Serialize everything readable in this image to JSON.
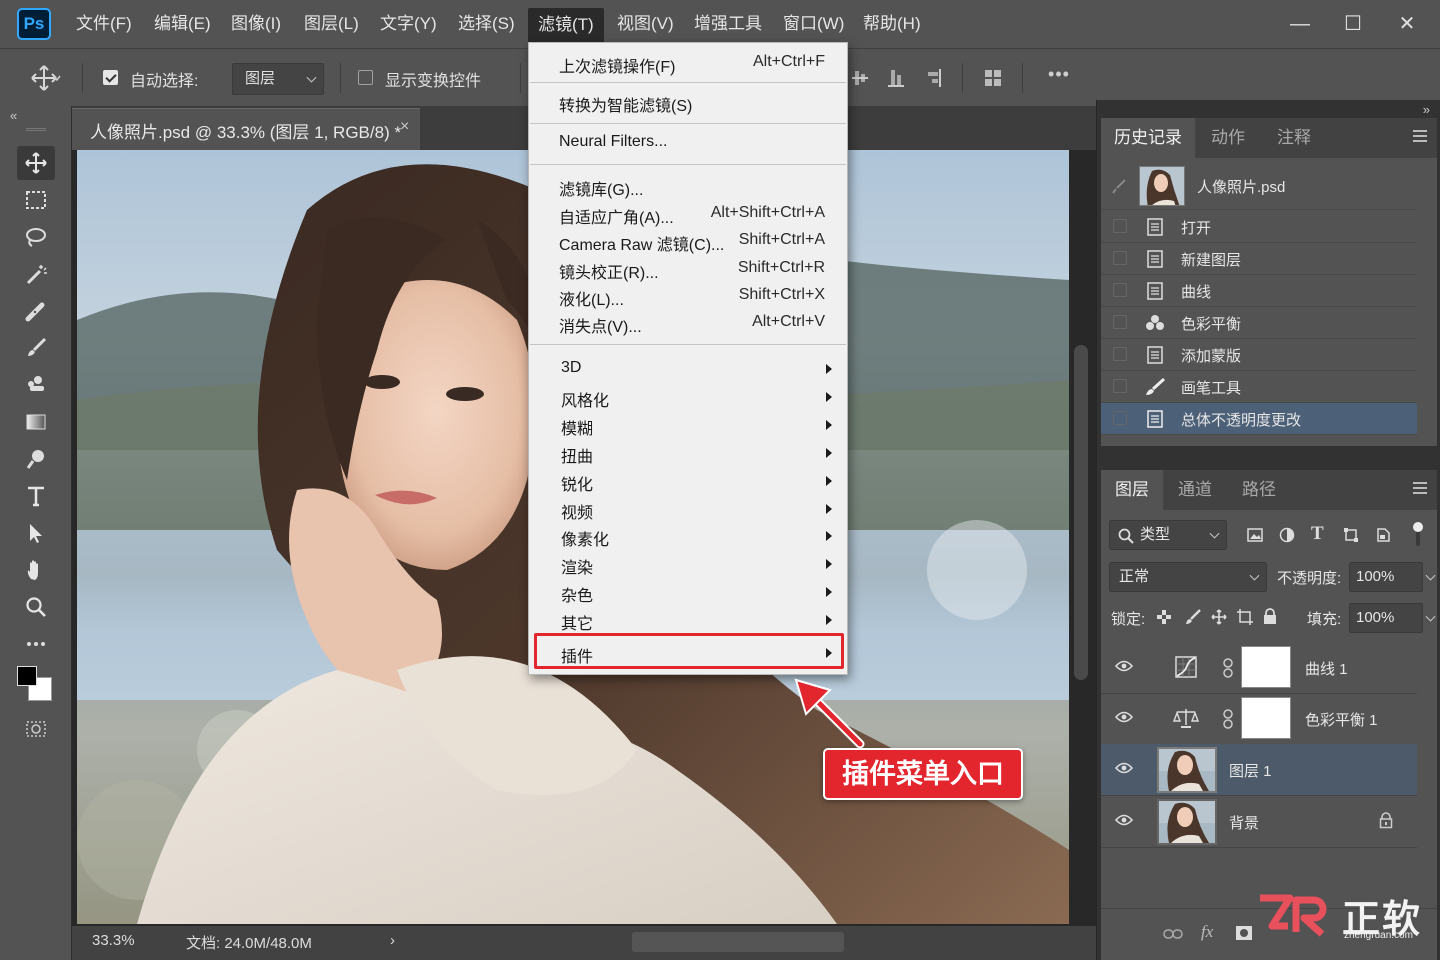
{
  "app": {
    "logo": "Ps"
  },
  "menubar": {
    "items": [
      "文件(F)",
      "编辑(E)",
      "图像(I)",
      "图层(L)",
      "文字(Y)",
      "选择(S)",
      "滤镜(T)",
      "视图(V)",
      "增强工具",
      "窗口(W)",
      "帮助(H)"
    ],
    "active": "滤镜(T)",
    "window_controls": {
      "minimize": "—",
      "maximize": "☐",
      "close": "✕"
    }
  },
  "options": {
    "auto_select_label": "自动选择:",
    "auto_select_checked": true,
    "auto_select_target": "图层",
    "show_transform_label": "显示变换控件",
    "show_transform_checked": false,
    "more": "•••"
  },
  "collapse_left": "«",
  "collapse_right": "»",
  "document": {
    "tab_title": "人像照片.psd @ 33.3% (图层 1, RGB/8) *",
    "close": "×"
  },
  "status": {
    "zoom": "33.3%",
    "doc_size": "文档: 24.0M/48.0M",
    "arrow": "›"
  },
  "filter_menu": {
    "group1": [
      {
        "label": "上次滤镜操作(F)",
        "shortcut": "Alt+Ctrl+F"
      }
    ],
    "group2": [
      {
        "label": "转换为智能滤镜(S)",
        "shortcut": ""
      }
    ],
    "group3": [
      {
        "label": "Neural Filters...",
        "shortcut": ""
      }
    ],
    "group4": [
      {
        "label": "滤镜库(G)...",
        "shortcut": ""
      },
      {
        "label": "自适应广角(A)...",
        "shortcut": "Alt+Shift+Ctrl+A"
      },
      {
        "label": "Camera Raw 滤镜(C)...",
        "shortcut": "Shift+Ctrl+A"
      },
      {
        "label": "镜头校正(R)...",
        "shortcut": "Shift+Ctrl+R"
      },
      {
        "label": "液化(L)...",
        "shortcut": "Shift+Ctrl+X"
      },
      {
        "label": "消失点(V)...",
        "shortcut": "Alt+Ctrl+V"
      }
    ],
    "submenus": [
      "3D",
      "风格化",
      "模糊",
      "扭曲",
      "锐化",
      "视频",
      "像素化",
      "渲染",
      "杂色",
      "其它"
    ],
    "plugin_item": "插件"
  },
  "annotation": {
    "text": "插件菜单入口",
    "color": "#e3262e"
  },
  "history_panel": {
    "tabs": [
      "历史记录",
      "动作",
      "注释"
    ],
    "snapshot": "人像照片.psd",
    "steps": [
      {
        "label": "打开",
        "icon": "document-icon"
      },
      {
        "label": "新建图层",
        "icon": "document-icon"
      },
      {
        "label": "曲线",
        "icon": "document-icon"
      },
      {
        "label": "色彩平衡",
        "icon": "color-balance-icon"
      },
      {
        "label": "添加蒙版",
        "icon": "document-icon"
      },
      {
        "label": "画笔工具",
        "icon": "brush-icon"
      },
      {
        "label": "总体不透明度更改",
        "icon": "document-icon",
        "selected": true
      }
    ]
  },
  "layers_panel": {
    "tabs": [
      "图层",
      "通道",
      "路径"
    ],
    "filter_kind": "类型",
    "blend_mode": "正常",
    "opacity_label": "不透明度:",
    "opacity_value": "100%",
    "lock_label": "锁定:",
    "fill_label": "填充:",
    "fill_value": "100%",
    "layers": [
      {
        "name": "曲线 1",
        "type": "adjustment-curves"
      },
      {
        "name": "色彩平衡 1",
        "type": "adjustment-color-balance"
      },
      {
        "name": "图层 1",
        "type": "pixel",
        "selected": true
      },
      {
        "name": "背景",
        "type": "background",
        "locked": true
      }
    ],
    "footer_icons": [
      "link-icon",
      "fx-icon",
      "mask-icon"
    ]
  },
  "watermark": {
    "logo": "ZR",
    "text": "正软",
    "url": "zhengruan.com"
  },
  "colors": {
    "accent_red": "#e3262e",
    "selection_blue": "#4c6078",
    "ps_blue": "#31a8ff"
  }
}
